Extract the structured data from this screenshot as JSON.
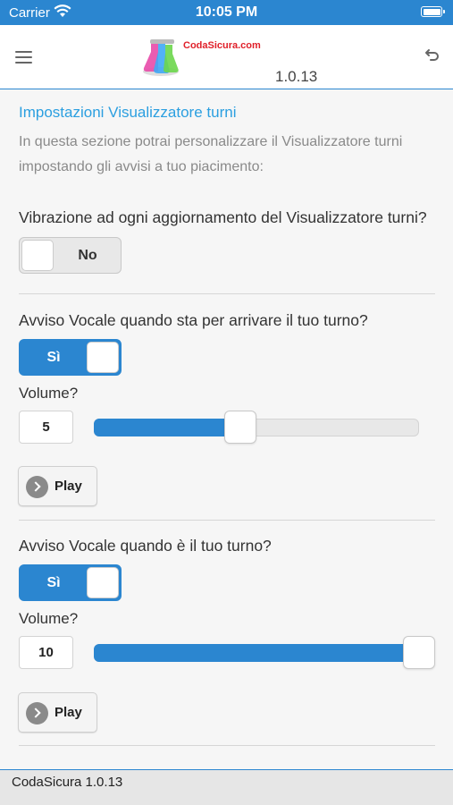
{
  "statusbar": {
    "carrier": "Carrier",
    "time": "10:05 PM"
  },
  "navbar": {
    "brand": "CodaSicura.com",
    "version": "1.0.13",
    "menu_icon": "hamburger-icon",
    "undo_icon": "undo-icon"
  },
  "section": {
    "title": "Impostazioni Visualizzatore turni",
    "description": "In questa sezione potrai personalizzare il Visualizzatore turni impostando gli avvisi a tuo piacimento:"
  },
  "vibration": {
    "question": "Vibrazione ad ogni aggiornamento del Visualizzatore turni?",
    "toggle_label": "No",
    "enabled": false
  },
  "warning_near": {
    "question": "Avviso Vocale quando sta per arrivare il tuo turno?",
    "toggle_label": "Sì",
    "enabled": true,
    "volume_label": "Volume?",
    "volume_value": "5",
    "volume_fraction": 0.45,
    "play_label": "Play"
  },
  "warning_turn": {
    "question": "Avviso Vocale quando è il tuo turno?",
    "toggle_label": "Sì",
    "enabled": true,
    "volume_label": "Volume?",
    "volume_value": "10",
    "volume_fraction": 1.0,
    "play_label": "Play"
  },
  "footer": {
    "text": "CodaSicura 1.0.13"
  },
  "colors": {
    "accent": "#2b86d0",
    "title": "#2b9fe0",
    "brand": "#e0202a"
  }
}
